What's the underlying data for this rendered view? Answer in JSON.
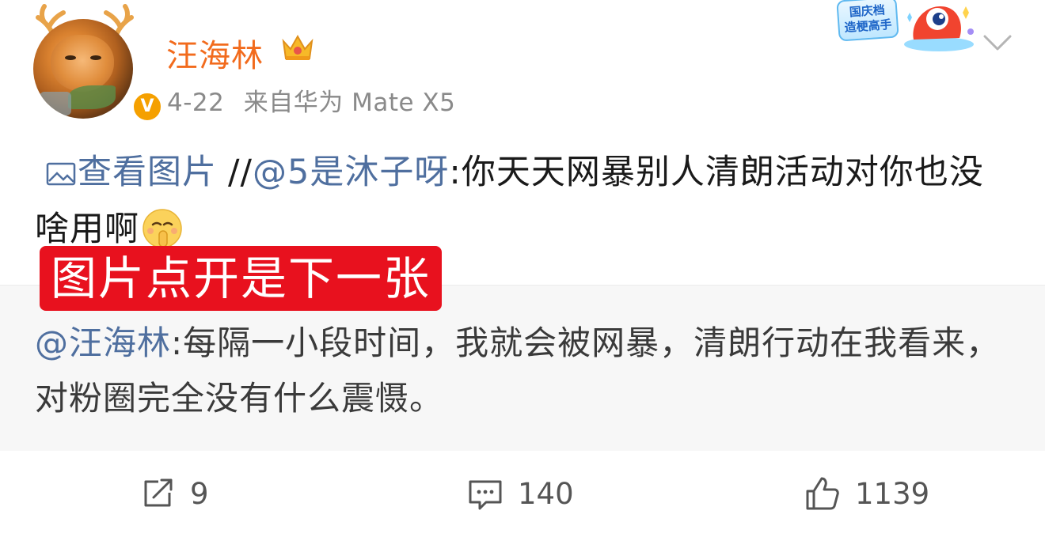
{
  "post": {
    "author": "汪海林",
    "date": "4-22",
    "source": "来自华为 Mate X5",
    "view_image_label": "查看图片",
    "slashes": "//",
    "quoted_user": "@5是沐子呀",
    "quoted_text": ":你天天网暴别人清朗活动对你也没啥用啊"
  },
  "overlay": {
    "text": "图片点开是下一张"
  },
  "retweet": {
    "mention": "@汪海林",
    "text": ":每隔一小段时间，我就会被网暴，清朗行动在我看来，对粉圈完全没有什么震慑。"
  },
  "sticker": {
    "line1": "国庆档",
    "line2": "造梗高手"
  },
  "actions": {
    "repost_count": "9",
    "comment_count": "140",
    "like_count": "1139"
  },
  "colors": {
    "username": "#f26b1d",
    "link": "#4f6f9f",
    "overlay": "#e8111e",
    "verify": "#f5a000",
    "retweet_bg": "#f7f7f7"
  },
  "icons": {
    "verify": "verified-v-badge",
    "crown": "crown-icon",
    "picture": "picture-icon",
    "emoji": "shush-emoji",
    "menu": "chevron-down-icon",
    "repost": "repost-icon",
    "comment": "comment-icon",
    "like": "thumbs-up-icon"
  }
}
